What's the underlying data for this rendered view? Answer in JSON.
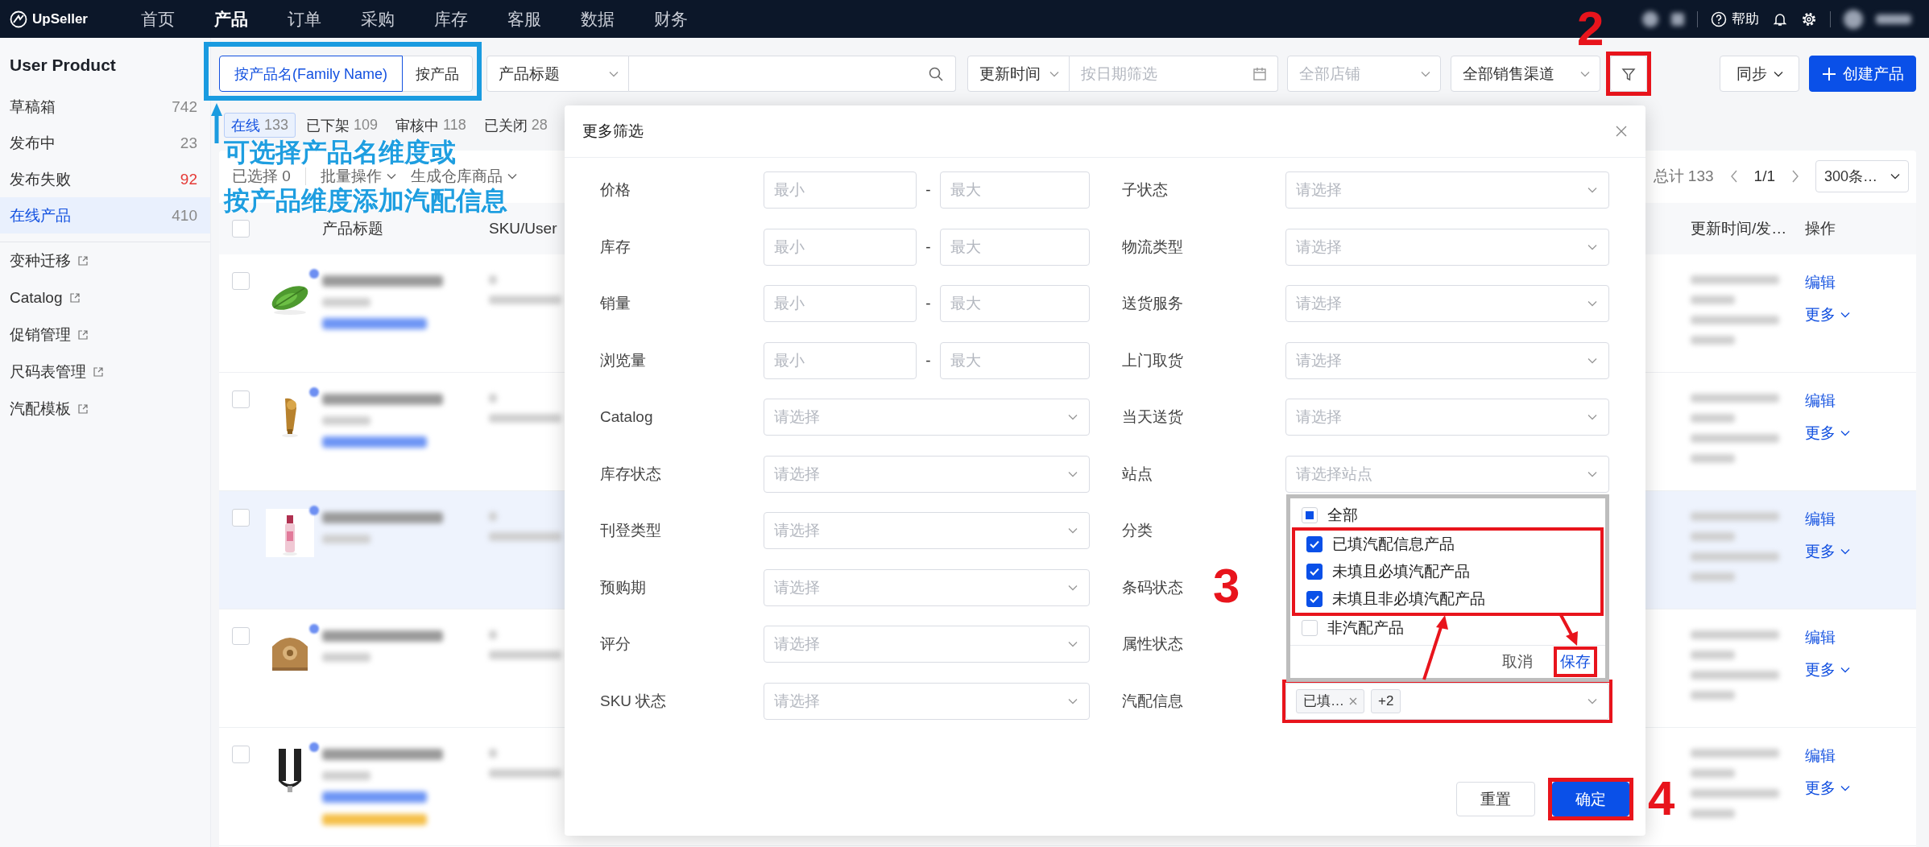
{
  "nav": {
    "logo": "UpSeller",
    "items": [
      {
        "label": "首页",
        "selected": false
      },
      {
        "label": "产品",
        "selected": true
      },
      {
        "label": "订单",
        "selected": false
      },
      {
        "label": "采购",
        "selected": false
      },
      {
        "label": "库存",
        "selected": false
      },
      {
        "label": "客服",
        "selected": false
      },
      {
        "label": "数据",
        "selected": false
      },
      {
        "label": "财务",
        "selected": false
      }
    ],
    "help": "帮助"
  },
  "sidebar": {
    "title": "User Product",
    "items": [
      {
        "label": "草稿箱",
        "count": "742",
        "alert": false,
        "selected": false
      },
      {
        "label": "发布中",
        "count": "23",
        "alert": false,
        "selected": false
      },
      {
        "label": "发布失败",
        "count": "92",
        "alert": true,
        "selected": false
      },
      {
        "label": "在线产品",
        "count": "410",
        "alert": false,
        "selected": true
      }
    ],
    "links": [
      "变种迁移",
      "Catalog",
      "促销管理",
      "尺码表管理",
      "汽配模板"
    ]
  },
  "toolbar": {
    "view_toggle": [
      {
        "label": "按产品名(Family Name)",
        "selected": true
      },
      {
        "label": "按产品",
        "selected": false
      }
    ],
    "search_scope": "产品标题",
    "time_field": "更新时间",
    "date_placeholder": "按日期筛选",
    "shop_placeholder": "全部店铺",
    "channel": "全部销售渠道",
    "sync": "同步",
    "create": "创建产品"
  },
  "status_tabs": [
    {
      "label": "在线",
      "count": "133",
      "selected": true
    },
    {
      "label": "已下架",
      "count": "109",
      "selected": false
    },
    {
      "label": "审核中",
      "count": "118",
      "selected": false
    },
    {
      "label": "已关闭",
      "count": "28",
      "selected": false
    }
  ],
  "bulk_bar": {
    "selected_text": "已选择 0",
    "bulk_action": "批量操作",
    "generate": "生成仓库商品",
    "total": "总计 133",
    "page": "1/1",
    "page_size": "300条…"
  },
  "table": {
    "header_checked": false,
    "columns": [
      "产品标题",
      "SKU/User"
    ],
    "right_columns": [
      "更新时间/发…",
      "操作"
    ],
    "rows": [
      {
        "checked": false,
        "hovered": false,
        "has_variants": true,
        "has_tag": false,
        "edit": "编辑",
        "more": "更多"
      },
      {
        "checked": false,
        "hovered": false,
        "has_variants": true,
        "has_tag": false,
        "edit": "编辑",
        "more": "更多"
      },
      {
        "checked": false,
        "hovered": true,
        "has_variants": false,
        "has_tag": false,
        "edit": "编辑",
        "more": "更多"
      },
      {
        "checked": false,
        "hovered": false,
        "has_variants": false,
        "has_tag": false,
        "edit": "编辑",
        "more": "更多"
      },
      {
        "checked": false,
        "hovered": false,
        "has_variants": true,
        "has_tag": true,
        "edit": "编辑",
        "more": "更多"
      }
    ]
  },
  "modal": {
    "title": "更多筛选",
    "left_fields": [
      {
        "label": "价格",
        "kind": "range",
        "min_placeholder": "最小",
        "separator": "-",
        "max_placeholder": "最大"
      },
      {
        "label": "库存",
        "kind": "range",
        "min_placeholder": "最小",
        "separator": "-",
        "max_placeholder": "最大"
      },
      {
        "label": "销量",
        "kind": "range",
        "min_placeholder": "最小",
        "separator": "-",
        "max_placeholder": "最大"
      },
      {
        "label": "浏览量",
        "kind": "range",
        "min_placeholder": "最小",
        "separator": "-",
        "max_placeholder": "最大"
      },
      {
        "label": "Catalog",
        "kind": "select",
        "placeholder": "请选择"
      },
      {
        "label": "库存状态",
        "kind": "select",
        "placeholder": "请选择"
      },
      {
        "label": "刊登类型",
        "kind": "select",
        "placeholder": "请选择"
      },
      {
        "label": "预购期",
        "kind": "select",
        "placeholder": "请选择"
      },
      {
        "label": "评分",
        "kind": "select",
        "placeholder": "请选择"
      },
      {
        "label": "SKU 状态",
        "kind": "select",
        "placeholder": "请选择"
      }
    ],
    "right_fields": [
      {
        "label": "子状态",
        "kind": "select",
        "placeholder": "请选择"
      },
      {
        "label": "物流类型",
        "kind": "select",
        "placeholder": "请选择"
      },
      {
        "label": "送货服务",
        "kind": "select",
        "placeholder": "请选择"
      },
      {
        "label": "上门取货",
        "kind": "select",
        "placeholder": "请选择"
      },
      {
        "label": "当天送货",
        "kind": "select",
        "placeholder": "请选择"
      },
      {
        "label": "站点",
        "kind": "select",
        "placeholder": "请选择站点"
      },
      {
        "label": "分类",
        "kind": "covered"
      },
      {
        "label": "条码状态",
        "kind": "covered"
      },
      {
        "label": "属性状态",
        "kind": "covered"
      },
      {
        "label": "汽配信息",
        "kind": "tags",
        "tags": [
          {
            "label": "已填…",
            "removable": true
          },
          {
            "label": "+2",
            "removable": false
          }
        ]
      }
    ],
    "popup": {
      "options": [
        {
          "label": "全部",
          "checked": false,
          "indeterminate": true
        },
        {
          "label": "已填汽配信息产品",
          "checked": true,
          "indeterminate": false
        },
        {
          "label": "未填且必填汽配产品",
          "checked": true,
          "indeterminate": false
        },
        {
          "label": "未填且非必填汽配产品",
          "checked": true,
          "indeterminate": false
        },
        {
          "label": "非汽配产品",
          "checked": false,
          "indeterminate": false
        }
      ],
      "cancel": "取消",
      "save": "保存"
    },
    "reset": "重置",
    "confirm": "确定"
  },
  "annotations": {
    "callout": [
      "可选择产品名维度或",
      "按产品维度添加汽配信息"
    ],
    "steps": [
      "2",
      "3",
      "4"
    ]
  }
}
